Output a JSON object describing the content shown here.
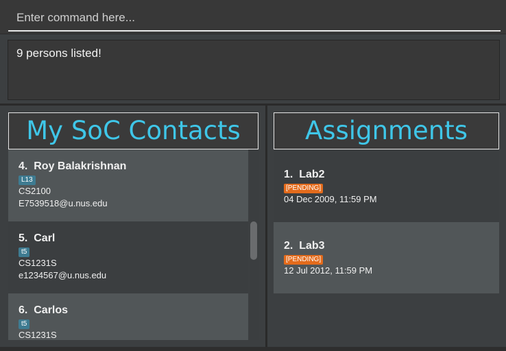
{
  "command": {
    "placeholder": "Enter command here..."
  },
  "result": {
    "message": "9 persons listed!"
  },
  "contacts_panel": {
    "title": "My SoC Contacts",
    "cards": [
      {
        "index": "4.",
        "name": "Roy Balakrishnan",
        "tag": "L13",
        "module": "CS2100",
        "email": "E7539518@u.nus.edu"
      },
      {
        "index": "5.",
        "name": "Carl",
        "tag": "t5",
        "module": "CS1231S",
        "email": "e1234567@u.nus.edu"
      },
      {
        "index": "6.",
        "name": "Carlos",
        "tag": "t5",
        "module": "CS1231S",
        "email": ""
      }
    ]
  },
  "assignments_panel": {
    "title": "Assignments",
    "cards": [
      {
        "index": "1.",
        "name": "Lab2",
        "status": "[PENDING]",
        "deadline": "04 Dec 2009, 11:59 PM"
      },
      {
        "index": "2.",
        "name": "Lab3",
        "status": "[PENDING]",
        "deadline": "12 Jul 2012, 11:59 PM"
      }
    ]
  },
  "colors": {
    "accent": "#3fc6e8",
    "tag": "#3e7b91",
    "status": "#e36b1c",
    "background": "#3c3f41"
  }
}
